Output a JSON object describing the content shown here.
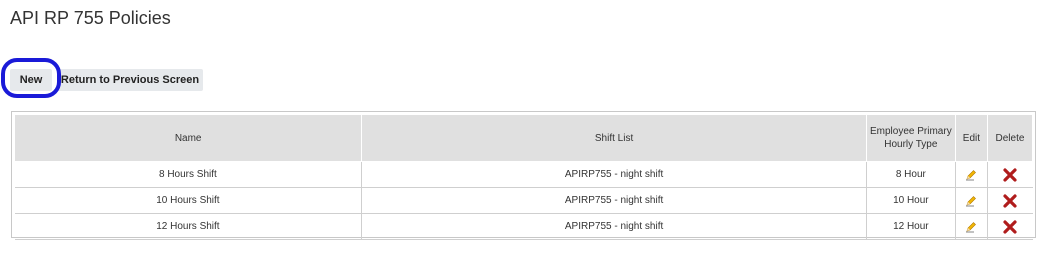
{
  "page": {
    "title": "API RP 755 Policies"
  },
  "toolbar": {
    "new_label": "New",
    "return_label": "Return to Previous Screen"
  },
  "table": {
    "headers": {
      "name": "Name",
      "shift_list": "Shift List",
      "hourly_type": "Employee Primary Hourly Type",
      "edit": "Edit",
      "delete": "Delete"
    },
    "rows": [
      {
        "name": "8 Hours Shift",
        "shift_list": "APIRP755 - night shift",
        "hourly_type": "8 Hour"
      },
      {
        "name": "10 Hours Shift",
        "shift_list": "APIRP755 - night shift",
        "hourly_type": "10 Hour"
      },
      {
        "name": "12 Hours Shift",
        "shift_list": "APIRP755 - night shift",
        "hourly_type": "12 Hour"
      }
    ]
  },
  "icons": {
    "edit": "pencil-icon",
    "delete": "red-x-icon"
  },
  "colors": {
    "highlight": "#1a1ad8",
    "delete": "#b01c1c",
    "header_bg": "#e0e0e0"
  }
}
